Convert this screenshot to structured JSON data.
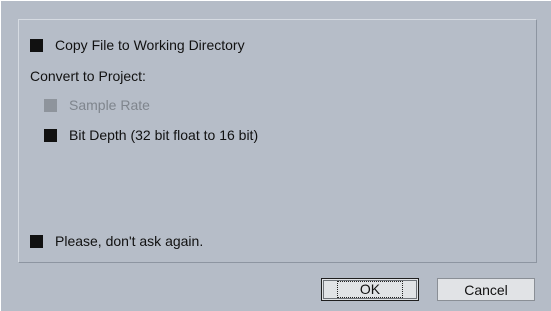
{
  "options": {
    "copy_file": {
      "label": "Copy File to Working Directory",
      "checked": true,
      "enabled": true
    },
    "convert_heading": "Convert to Project:",
    "sample_rate": {
      "label": "Sample Rate",
      "checked": true,
      "enabled": false
    },
    "bit_depth": {
      "label": "Bit Depth (32 bit float to 16 bit)",
      "checked": true,
      "enabled": true
    },
    "dont_ask": {
      "label": "Please, don't ask again.",
      "checked": true,
      "enabled": true
    }
  },
  "buttons": {
    "ok_label": "OK",
    "cancel_label": "Cancel"
  },
  "colors": {
    "background": "#b5bcc7",
    "checkbox_fill": "#111111",
    "checkbox_disabled": "#8e949c",
    "button_face": "#e1e3e6"
  }
}
